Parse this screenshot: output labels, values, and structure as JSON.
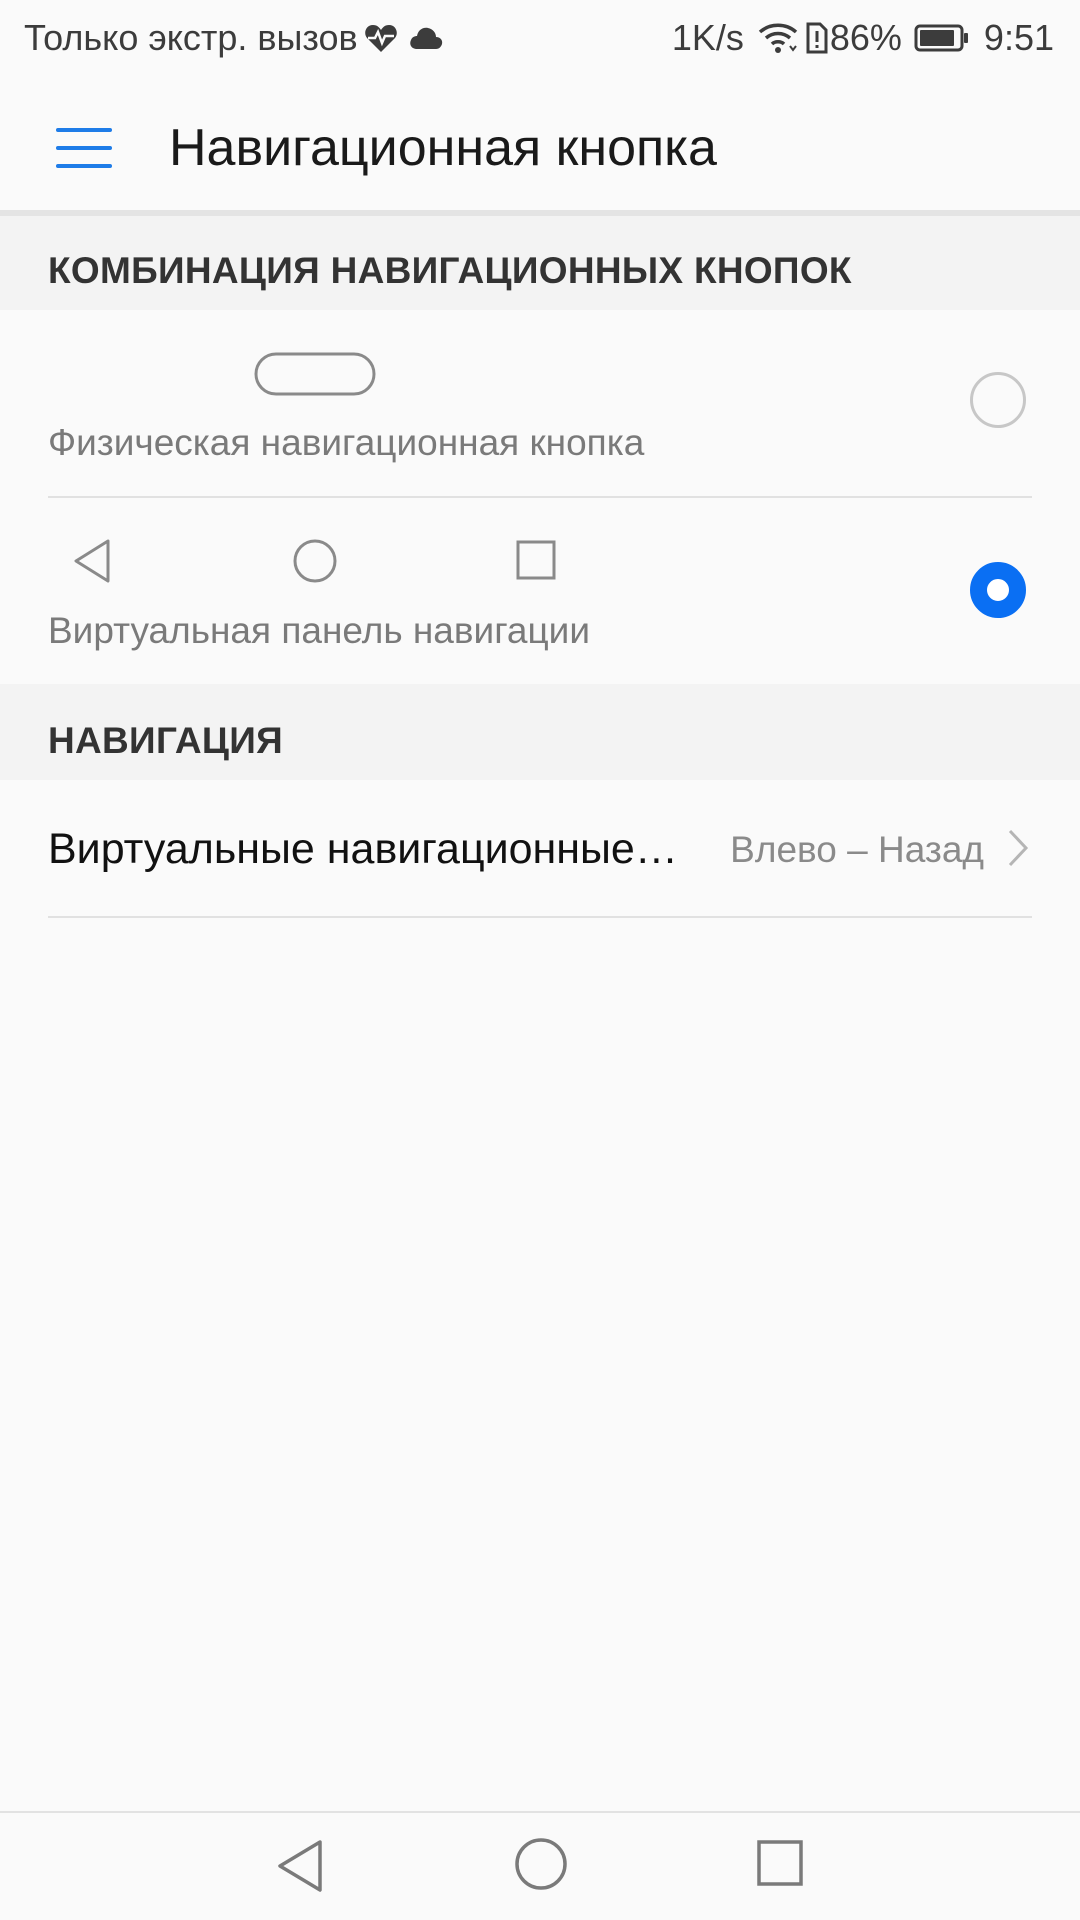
{
  "status_bar": {
    "carrier_text": "Только экстр. вызов",
    "net_speed": "1K/s",
    "battery_percent": "86%",
    "time": "9:51",
    "icons": [
      "heart-pulse-icon",
      "cloud-icon",
      "wifi-icon",
      "sim-alert-icon",
      "battery-icon"
    ]
  },
  "app_bar": {
    "title": "Навигационная кнопка",
    "menu_icon": "hamburger-menu-icon",
    "accent_color": "#1e7ce8"
  },
  "sections": {
    "combination": {
      "header": "КОМБИНАЦИЯ НАВИГАЦИОННЫХ КНОПОК",
      "options": [
        {
          "label": "Физическая навигационная кнопка",
          "selected": false
        },
        {
          "label": "Виртуальная панель навигации",
          "selected": true
        }
      ]
    },
    "navigation": {
      "header": "НАВИГАЦИЯ",
      "item": {
        "title": "Виртуальные навигационные кнопки",
        "value": "Влево – Назад"
      }
    }
  },
  "colors": {
    "radio_selected": "#0a6ff3",
    "section_bg": "#f3f3f3",
    "page_bg": "#fafafa"
  },
  "system_nav": {
    "buttons": [
      "back-icon",
      "home-icon",
      "recents-icon"
    ]
  }
}
